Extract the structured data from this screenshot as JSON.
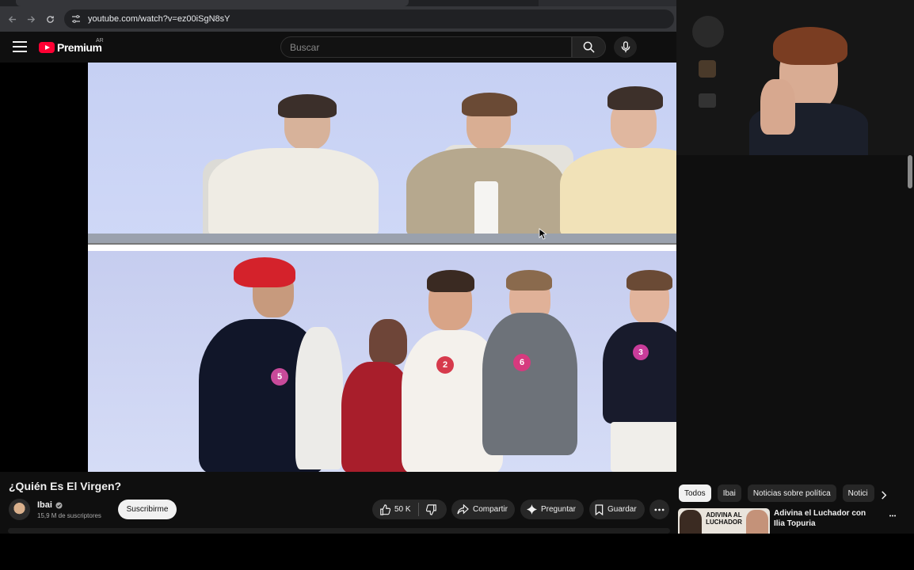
{
  "browser": {
    "url": "youtube.com/watch?v=ez00iSgN8sY"
  },
  "header": {
    "logo_text": "Premium",
    "country_code": "AR",
    "search_placeholder": "Buscar"
  },
  "video": {
    "title": "¿Quién Es El Virgen?",
    "channel": {
      "name": "Ibai",
      "subscribers": "15,9 M de suscriptores",
      "subscribe_label": "Suscribirme"
    },
    "actions": {
      "like_count": "50 K",
      "share_label": "Compartir",
      "ask_label": "Preguntar",
      "save_label": "Guardar"
    },
    "jersey_numbers": [
      "5",
      "2",
      "6",
      "3"
    ]
  },
  "sidebar": {
    "chips": [
      "Todos",
      "Ibai",
      "Noticias sobre política",
      "Notici"
    ],
    "recommendation": {
      "title": "Adivina el Luchador con Ilia Topuria",
      "thumbnail_text": "ADIVINA AL LUCHADOR"
    }
  },
  "colors": {
    "youtube_red": "#ff0033",
    "background": "#0f0f0f",
    "chip_active": "#f1f1f1"
  }
}
